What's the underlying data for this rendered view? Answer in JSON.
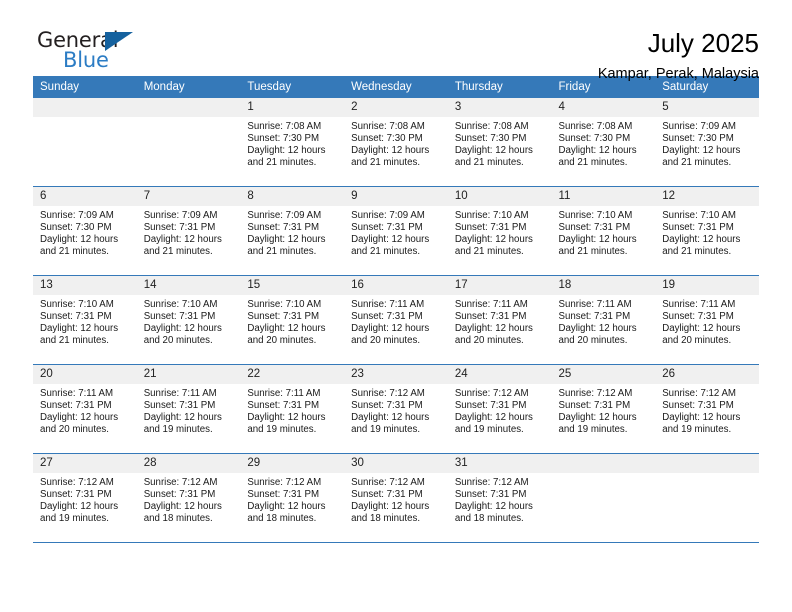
{
  "brand": {
    "name_top": "General",
    "name_bottom": "Blue",
    "triangle_icon": "triangle-icon",
    "color_dark": "#231f20",
    "color_blue": "#2b7cc4",
    "color_triangle": "#15619e"
  },
  "header": {
    "title": "July 2025",
    "subtitle": "Kampar, Perak, Malaysia"
  },
  "theme": {
    "header_row_bg": "#3579b9",
    "daynum_bg": "#f0f0f0",
    "grid_line": "#3579b9"
  },
  "weekday_headers": [
    "Sunday",
    "Monday",
    "Tuesday",
    "Wednesday",
    "Thursday",
    "Friday",
    "Saturday"
  ],
  "weeks": [
    [
      {
        "day": "",
        "empty": true
      },
      {
        "day": "",
        "empty": true
      },
      {
        "day": "1",
        "sunrise": "Sunrise: 7:08 AM",
        "sunset": "Sunset: 7:30 PM",
        "daylight": "Daylight: 12 hours and 21 minutes."
      },
      {
        "day": "2",
        "sunrise": "Sunrise: 7:08 AM",
        "sunset": "Sunset: 7:30 PM",
        "daylight": "Daylight: 12 hours and 21 minutes."
      },
      {
        "day": "3",
        "sunrise": "Sunrise: 7:08 AM",
        "sunset": "Sunset: 7:30 PM",
        "daylight": "Daylight: 12 hours and 21 minutes."
      },
      {
        "day": "4",
        "sunrise": "Sunrise: 7:08 AM",
        "sunset": "Sunset: 7:30 PM",
        "daylight": "Daylight: 12 hours and 21 minutes."
      },
      {
        "day": "5",
        "sunrise": "Sunrise: 7:09 AM",
        "sunset": "Sunset: 7:30 PM",
        "daylight": "Daylight: 12 hours and 21 minutes."
      }
    ],
    [
      {
        "day": "6",
        "sunrise": "Sunrise: 7:09 AM",
        "sunset": "Sunset: 7:30 PM",
        "daylight": "Daylight: 12 hours and 21 minutes."
      },
      {
        "day": "7",
        "sunrise": "Sunrise: 7:09 AM",
        "sunset": "Sunset: 7:31 PM",
        "daylight": "Daylight: 12 hours and 21 minutes."
      },
      {
        "day": "8",
        "sunrise": "Sunrise: 7:09 AM",
        "sunset": "Sunset: 7:31 PM",
        "daylight": "Daylight: 12 hours and 21 minutes."
      },
      {
        "day": "9",
        "sunrise": "Sunrise: 7:09 AM",
        "sunset": "Sunset: 7:31 PM",
        "daylight": "Daylight: 12 hours and 21 minutes."
      },
      {
        "day": "10",
        "sunrise": "Sunrise: 7:10 AM",
        "sunset": "Sunset: 7:31 PM",
        "daylight": "Daylight: 12 hours and 21 minutes."
      },
      {
        "day": "11",
        "sunrise": "Sunrise: 7:10 AM",
        "sunset": "Sunset: 7:31 PM",
        "daylight": "Daylight: 12 hours and 21 minutes."
      },
      {
        "day": "12",
        "sunrise": "Sunrise: 7:10 AM",
        "sunset": "Sunset: 7:31 PM",
        "daylight": "Daylight: 12 hours and 21 minutes."
      }
    ],
    [
      {
        "day": "13",
        "sunrise": "Sunrise: 7:10 AM",
        "sunset": "Sunset: 7:31 PM",
        "daylight": "Daylight: 12 hours and 21 minutes."
      },
      {
        "day": "14",
        "sunrise": "Sunrise: 7:10 AM",
        "sunset": "Sunset: 7:31 PM",
        "daylight": "Daylight: 12 hours and 20 minutes."
      },
      {
        "day": "15",
        "sunrise": "Sunrise: 7:10 AM",
        "sunset": "Sunset: 7:31 PM",
        "daylight": "Daylight: 12 hours and 20 minutes."
      },
      {
        "day": "16",
        "sunrise": "Sunrise: 7:11 AM",
        "sunset": "Sunset: 7:31 PM",
        "daylight": "Daylight: 12 hours and 20 minutes."
      },
      {
        "day": "17",
        "sunrise": "Sunrise: 7:11 AM",
        "sunset": "Sunset: 7:31 PM",
        "daylight": "Daylight: 12 hours and 20 minutes."
      },
      {
        "day": "18",
        "sunrise": "Sunrise: 7:11 AM",
        "sunset": "Sunset: 7:31 PM",
        "daylight": "Daylight: 12 hours and 20 minutes."
      },
      {
        "day": "19",
        "sunrise": "Sunrise: 7:11 AM",
        "sunset": "Sunset: 7:31 PM",
        "daylight": "Daylight: 12 hours and 20 minutes."
      }
    ],
    [
      {
        "day": "20",
        "sunrise": "Sunrise: 7:11 AM",
        "sunset": "Sunset: 7:31 PM",
        "daylight": "Daylight: 12 hours and 20 minutes."
      },
      {
        "day": "21",
        "sunrise": "Sunrise: 7:11 AM",
        "sunset": "Sunset: 7:31 PM",
        "daylight": "Daylight: 12 hours and 19 minutes."
      },
      {
        "day": "22",
        "sunrise": "Sunrise: 7:11 AM",
        "sunset": "Sunset: 7:31 PM",
        "daylight": "Daylight: 12 hours and 19 minutes."
      },
      {
        "day": "23",
        "sunrise": "Sunrise: 7:12 AM",
        "sunset": "Sunset: 7:31 PM",
        "daylight": "Daylight: 12 hours and 19 minutes."
      },
      {
        "day": "24",
        "sunrise": "Sunrise: 7:12 AM",
        "sunset": "Sunset: 7:31 PM",
        "daylight": "Daylight: 12 hours and 19 minutes."
      },
      {
        "day": "25",
        "sunrise": "Sunrise: 7:12 AM",
        "sunset": "Sunset: 7:31 PM",
        "daylight": "Daylight: 12 hours and 19 minutes."
      },
      {
        "day": "26",
        "sunrise": "Sunrise: 7:12 AM",
        "sunset": "Sunset: 7:31 PM",
        "daylight": "Daylight: 12 hours and 19 minutes."
      }
    ],
    [
      {
        "day": "27",
        "sunrise": "Sunrise: 7:12 AM",
        "sunset": "Sunset: 7:31 PM",
        "daylight": "Daylight: 12 hours and 19 minutes."
      },
      {
        "day": "28",
        "sunrise": "Sunrise: 7:12 AM",
        "sunset": "Sunset: 7:31 PM",
        "daylight": "Daylight: 12 hours and 18 minutes."
      },
      {
        "day": "29",
        "sunrise": "Sunrise: 7:12 AM",
        "sunset": "Sunset: 7:31 PM",
        "daylight": "Daylight: 12 hours and 18 minutes."
      },
      {
        "day": "30",
        "sunrise": "Sunrise: 7:12 AM",
        "sunset": "Sunset: 7:31 PM",
        "daylight": "Daylight: 12 hours and 18 minutes."
      },
      {
        "day": "31",
        "sunrise": "Sunrise: 7:12 AM",
        "sunset": "Sunset: 7:31 PM",
        "daylight": "Daylight: 12 hours and 18 minutes."
      },
      {
        "day": "",
        "empty": true
      },
      {
        "day": "",
        "empty": true
      }
    ]
  ]
}
